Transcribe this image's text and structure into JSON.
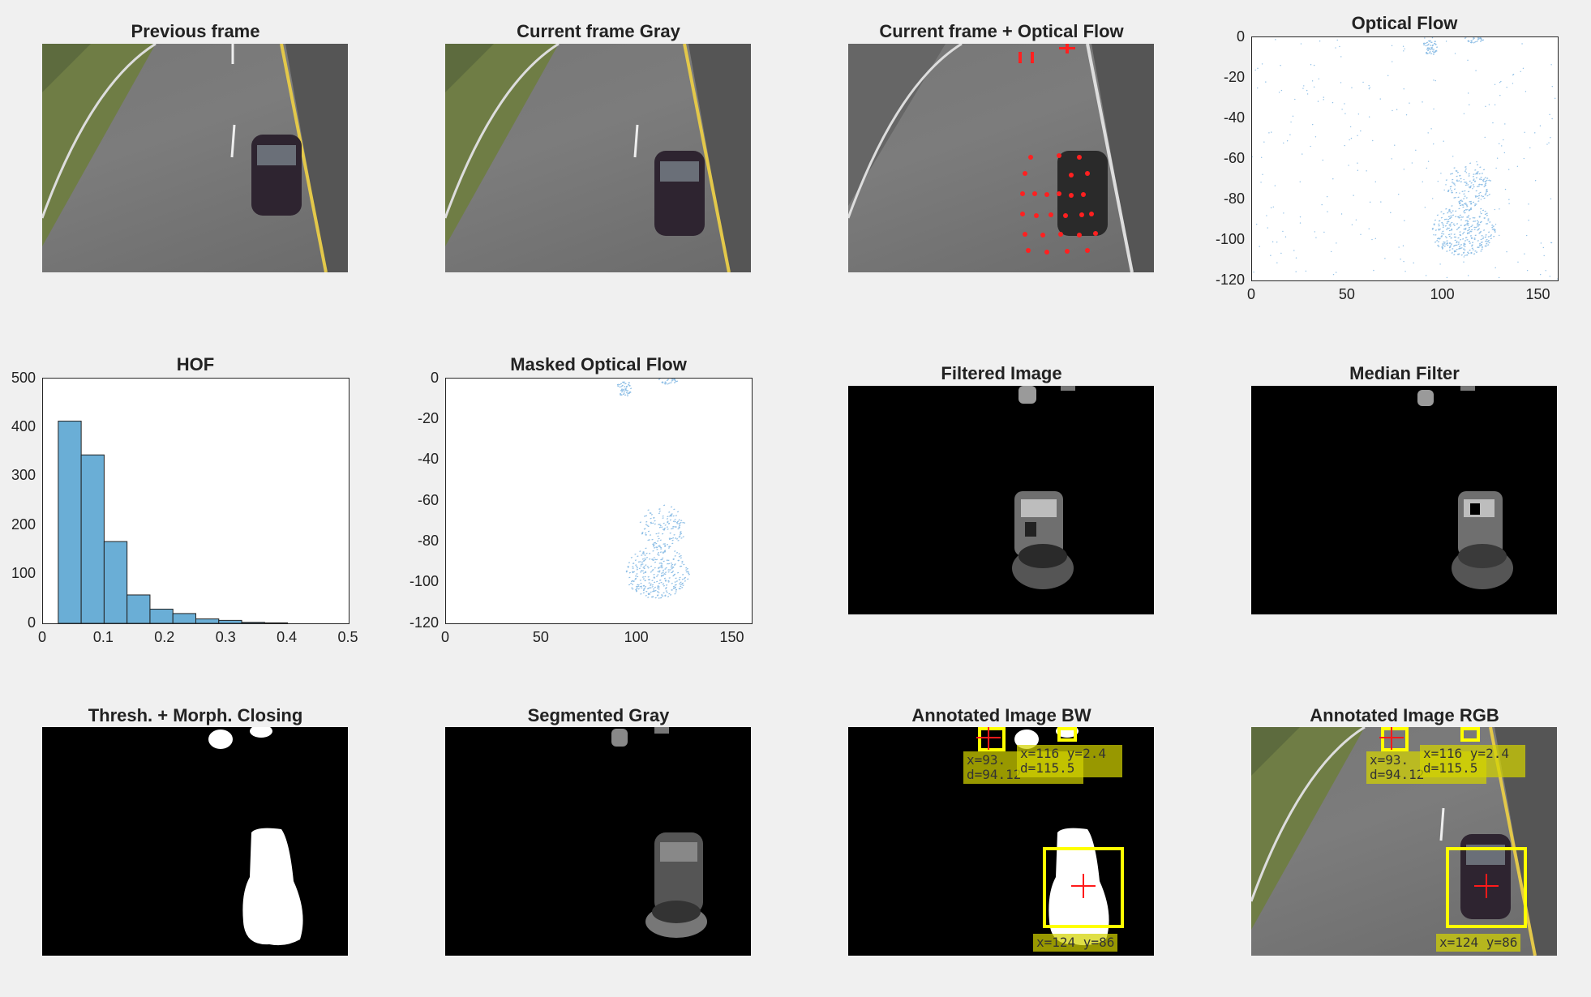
{
  "titles": {
    "previous_frame": "Previous frame",
    "current_gray": "Current frame Gray",
    "current_flow": "Current frame + Optical Flow",
    "optical_flow": "Optical Flow",
    "hof": "HOF",
    "masked_flow": "Masked Optical Flow",
    "filtered": "Filtered Image",
    "median": "Median Filter",
    "thresh": "Thresh. + Morph. Closing",
    "segmented": "Segmented Gray",
    "annot_bw": "Annotated Image BW",
    "annot_rgb": "Annotated Image RGB"
  },
  "annotations": {
    "small_left": "x=93.\nd=94.12",
    "small_right": "x=116 y=2.4\nd=115.5",
    "main": "x=124 y=86"
  },
  "chart_data": [
    {
      "type": "bar",
      "title": "HOF",
      "bin_edges": [
        0.025,
        0.0625,
        0.1,
        0.1375,
        0.175,
        0.2125,
        0.25,
        0.2875,
        0.325,
        0.3625,
        0.4
      ],
      "values": [
        413,
        344,
        167,
        58,
        29,
        20,
        9,
        6,
        2,
        1
      ],
      "xlim": [
        0,
        0.5
      ],
      "ylim": [
        0,
        500
      ],
      "xticks": [
        "0",
        "0.1",
        "0.2",
        "0.3",
        "0.4",
        "0.5"
      ],
      "yticks": [
        "0",
        "100",
        "200",
        "300",
        "400",
        "500"
      ],
      "bar_color": "#6aaed6"
    },
    {
      "type": "scatter",
      "title": "Optical Flow",
      "xlim": [
        0,
        160
      ],
      "ylim": [
        -120,
        0
      ],
      "xticks": [
        "0",
        "50",
        "100",
        "150"
      ],
      "yticks": [
        "0",
        "-20",
        "-40",
        "-60",
        "-80",
        "-100",
        "-120"
      ],
      "point_color": "#8fbfe6"
    },
    {
      "type": "scatter",
      "title": "Masked Optical Flow",
      "xlim": [
        0,
        160
      ],
      "ylim": [
        -120,
        0
      ],
      "xticks": [
        "0",
        "50",
        "100",
        "150"
      ],
      "yticks": [
        "0",
        "-20",
        "-40",
        "-60",
        "-80",
        "-100",
        "-120"
      ],
      "point_color": "#8fbfe6"
    }
  ]
}
